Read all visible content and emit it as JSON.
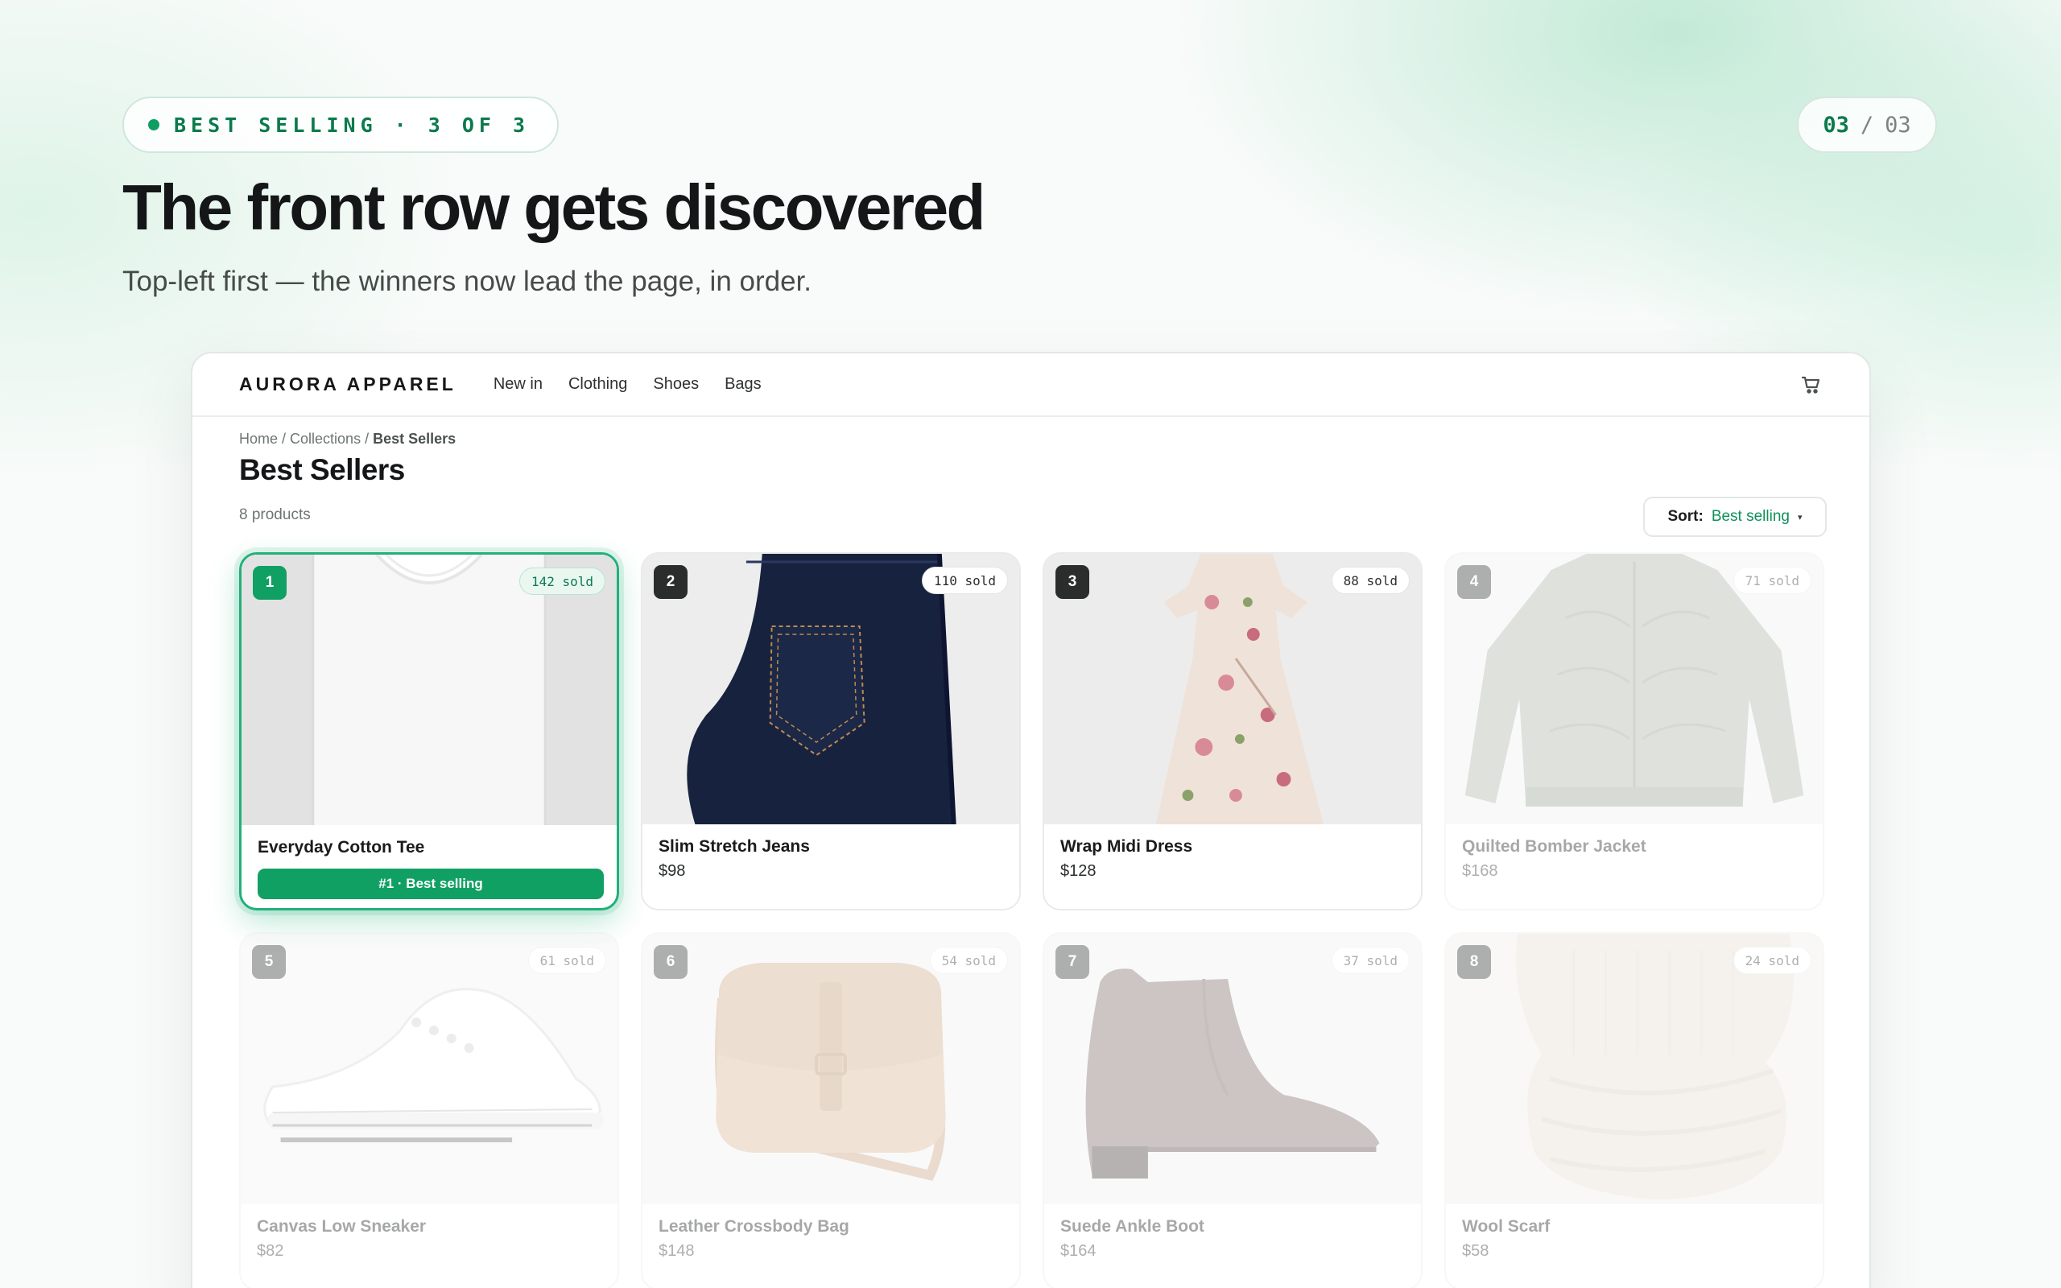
{
  "slide": {
    "eyebrow": "BEST SELLING · 3 OF 3",
    "pager_current": "03",
    "pager_sep": "/",
    "pager_total": "03",
    "headline": "The front row gets discovered",
    "subline": "Top-left first — the winners now lead the page, in order."
  },
  "store": {
    "brand": "AURORA APPAREL",
    "nav": [
      "New in",
      "Clothing",
      "Shoes",
      "Bags"
    ],
    "cart_icon": "cart-icon",
    "breadcrumb": {
      "home": "Home",
      "sep1": " / ",
      "collections": "Collections",
      "sep2": " / ",
      "current": "Best Sellers"
    },
    "title": "Best Sellers",
    "count": "8 products",
    "sort_label": "Sort:",
    "sort_value": "Best selling",
    "sort_caret": "▾",
    "accent": "#10a063"
  },
  "products": [
    {
      "rank": "1",
      "sold": "142 sold",
      "name": "Everyday Cotton Tee",
      "price": "",
      "badge": "#1 · Best selling"
    },
    {
      "rank": "2",
      "sold": "110 sold",
      "name": "Slim Stretch Jeans",
      "price": "$98",
      "badge": ""
    },
    {
      "rank": "3",
      "sold": "88 sold",
      "name": "Wrap Midi Dress",
      "price": "$128",
      "badge": ""
    },
    {
      "rank": "4",
      "sold": "71 sold",
      "name": "Quilted Bomber Jacket",
      "price": "$168",
      "badge": ""
    },
    {
      "rank": "5",
      "sold": "61 sold",
      "name": "Canvas Low Sneaker",
      "price": "$82",
      "badge": ""
    },
    {
      "rank": "6",
      "sold": "54 sold",
      "name": "Leather Crossbody Bag",
      "price": "$148",
      "badge": ""
    },
    {
      "rank": "7",
      "sold": "37 sold",
      "name": "Suede Ankle Boot",
      "price": "$164",
      "badge": ""
    },
    {
      "rank": "8",
      "sold": "24 sold",
      "name": "Wool Scarf",
      "price": "$58",
      "badge": ""
    }
  ]
}
